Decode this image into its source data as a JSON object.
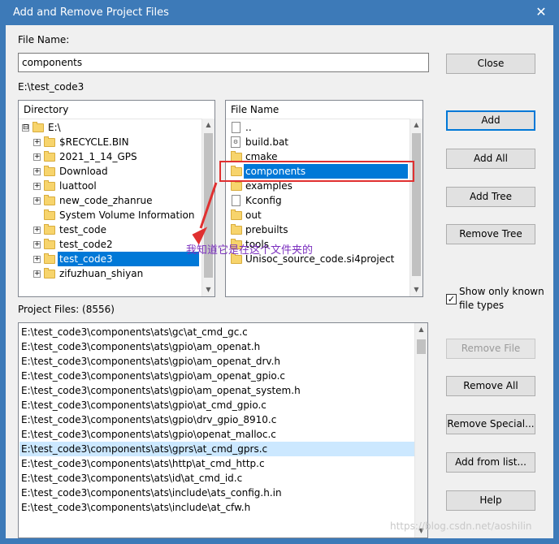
{
  "window": {
    "title": "Add and Remove Project Files",
    "close_glyph": "✕"
  },
  "file_name": {
    "label": "File Name:",
    "value": "components"
  },
  "current_path": "E:\\test_code3",
  "directory": {
    "header": "Directory",
    "items": [
      {
        "label": "E:\\",
        "expander": "⊟"
      },
      {
        "label": "$RECYCLE.BIN",
        "expander": "+"
      },
      {
        "label": "2021_1_14_GPS",
        "expander": "+"
      },
      {
        "label": "Download",
        "expander": "+"
      },
      {
        "label": "luattool",
        "expander": "+"
      },
      {
        "label": "new_code_zhanrue",
        "expander": "+"
      },
      {
        "label": "System Volume Information",
        "expander": ""
      },
      {
        "label": "test_code",
        "expander": "+"
      },
      {
        "label": "test_code2",
        "expander": "+"
      },
      {
        "label": "test_code3",
        "expander": "+",
        "selected": true
      },
      {
        "label": "zifuzhuan_shiyan",
        "expander": "+"
      }
    ]
  },
  "files": {
    "header": "File Name",
    "items": [
      {
        "label": "..",
        "icon": "file-icon"
      },
      {
        "label": "build.bat",
        "icon": "batch-file-icon"
      },
      {
        "label": "cmake",
        "icon": "folder-icon"
      },
      {
        "label": "components",
        "icon": "folder-icon",
        "selected": true
      },
      {
        "label": "examples",
        "icon": "folder-icon"
      },
      {
        "label": "Kconfig",
        "icon": "file-icon"
      },
      {
        "label": "out",
        "icon": "folder-icon"
      },
      {
        "label": "prebuilts",
        "icon": "folder-icon"
      },
      {
        "label": "tools",
        "icon": "folder-icon"
      },
      {
        "label": "Unisoc_source_code.si4project",
        "icon": "folder-icon"
      }
    ]
  },
  "annotation": {
    "text": "我知道它是在这个文件夹的",
    "color": "#7b2fbf",
    "highlight_color": "#e03030"
  },
  "project_files": {
    "label": "Project Files: (8556)",
    "items": [
      "E:\\test_code3\\components\\ats\\gc\\at_cmd_gc.c",
      "E:\\test_code3\\components\\ats\\gpio\\am_openat.h",
      "E:\\test_code3\\components\\ats\\gpio\\am_openat_drv.h",
      "E:\\test_code3\\components\\ats\\gpio\\am_openat_gpio.c",
      "E:\\test_code3\\components\\ats\\gpio\\am_openat_system.h",
      "E:\\test_code3\\components\\ats\\gpio\\at_cmd_gpio.c",
      "E:\\test_code3\\components\\ats\\gpio\\drv_gpio_8910.c",
      "E:\\test_code3\\components\\ats\\gpio\\openat_malloc.c",
      "E:\\test_code3\\components\\ats\\gprs\\at_cmd_gprs.c",
      "E:\\test_code3\\components\\ats\\http\\at_cmd_http.c",
      "E:\\test_code3\\components\\ats\\id\\at_cmd_id.c",
      "E:\\test_code3\\components\\ats\\include\\ats_config.h.in",
      "E:\\test_code3\\components\\ats\\include\\at_cfw.h"
    ],
    "selected_index": 8
  },
  "buttons": {
    "close": "Close",
    "add": "Add",
    "add_all": "Add All",
    "add_tree": "Add Tree",
    "remove_tree": "Remove Tree",
    "remove_file": "Remove File",
    "remove_all": "Remove All",
    "remove_special": "Remove Special...",
    "add_from_list": "Add from list...",
    "help": "Help"
  },
  "show_known": {
    "label_line1": "Show only known",
    "label_line2": "file types",
    "checked": true,
    "check_glyph": "✓"
  },
  "watermark": "https://blog.csdn.net/aoshilin"
}
